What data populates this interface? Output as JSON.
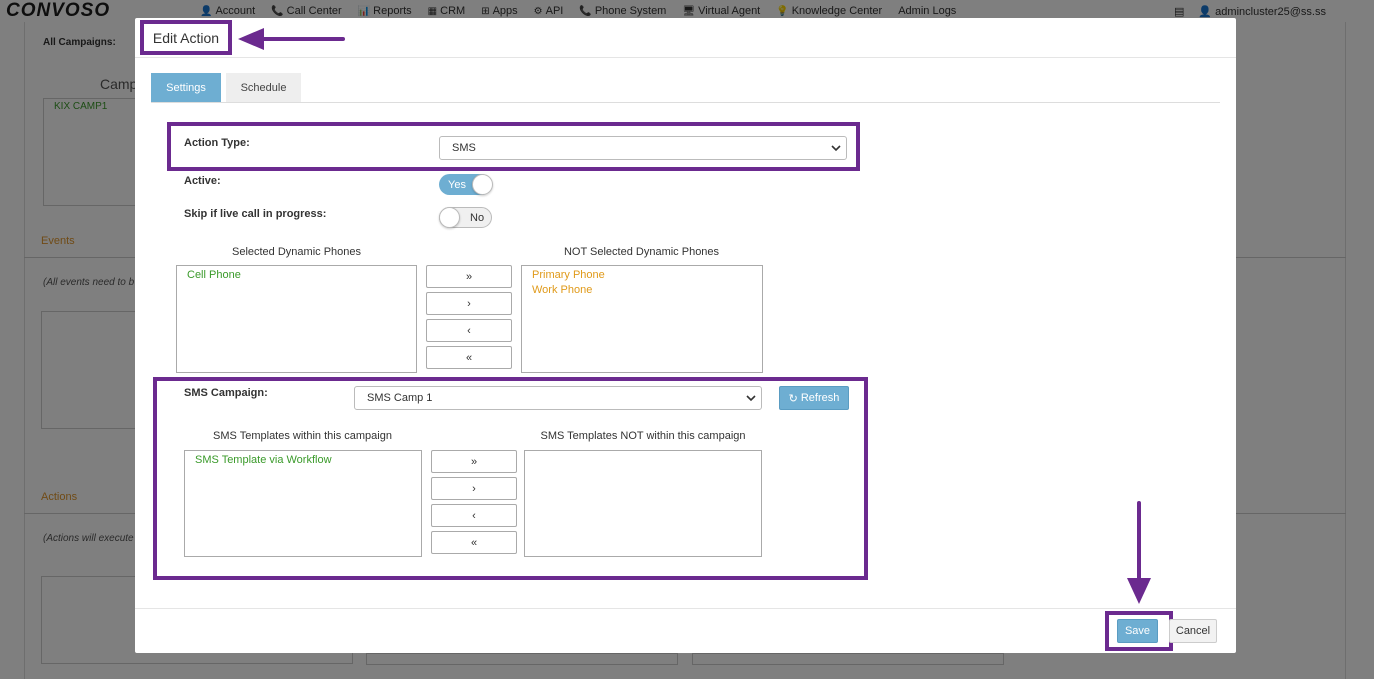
{
  "topnav": {
    "logo": "CONVOSO",
    "items": [
      {
        "icon": "person-icon",
        "glyph": "👤",
        "label": "Account"
      },
      {
        "icon": "phone-icon",
        "glyph": "📞",
        "label": "Call Center"
      },
      {
        "icon": "chart-icon",
        "glyph": "📊",
        "label": "Reports"
      },
      {
        "icon": "table-icon",
        "glyph": "▦",
        "label": "CRM"
      },
      {
        "icon": "grid-icon",
        "glyph": "⊞",
        "label": "Apps"
      },
      {
        "icon": "gear-icon",
        "glyph": "⚙",
        "label": "API"
      },
      {
        "icon": "phone-icon",
        "glyph": "📞",
        "label": "Phone System"
      },
      {
        "icon": "monitor-icon",
        "glyph": "🖥",
        "label": "Virtual Agent"
      },
      {
        "icon": "lightbulb-icon",
        "glyph": "💡",
        "label": "Knowledge Center"
      },
      {
        "icon": "",
        "glyph": "",
        "label": "Admin Logs"
      }
    ],
    "user": "admincluster25@ss.ss"
  },
  "background": {
    "all_campaigns_label": "All Campaigns:",
    "campaign_col": "Camp",
    "campaign_item": "KIX CAMP1",
    "events_heading": "Events",
    "events_note": "(All events need to b",
    "actions_heading": "Actions",
    "actions_note": "(Actions will execute"
  },
  "modal": {
    "title": "Edit Action",
    "tabs": {
      "settings": "Settings",
      "schedule": "Schedule"
    },
    "action_type": {
      "label": "Action Type:",
      "value": "SMS"
    },
    "active": {
      "label": "Active:",
      "value": "Yes"
    },
    "skip_live": {
      "label": "Skip if live call in progress:",
      "value": "No"
    },
    "phones": {
      "selected_title": "Selected Dynamic Phones",
      "not_selected_title": "NOT Selected Dynamic Phones",
      "selected": [
        "Cell Phone"
      ],
      "not_selected": [
        "Primary Phone",
        "Work Phone"
      ]
    },
    "move_buttons": {
      "all_right": "»",
      "right": "›",
      "left": "‹",
      "all_left": "«"
    },
    "sms_campaign": {
      "label": "SMS Campaign:",
      "value": "SMS Camp 1",
      "refresh": "Refresh"
    },
    "templates": {
      "within_title": "SMS Templates within this campaign",
      "not_within_title": "SMS Templates NOT within this campaign",
      "within": [
        "SMS Template via Workflow"
      ],
      "not_within": []
    },
    "footer": {
      "save": "Save",
      "cancel": "Cancel"
    }
  },
  "colors": {
    "accent": "#6eaed2",
    "highlight": "#6b2a8f",
    "green_item": "#3a9a2a",
    "orange_item": "#e09a1a",
    "bg_orange_heading": "#e0962c"
  }
}
